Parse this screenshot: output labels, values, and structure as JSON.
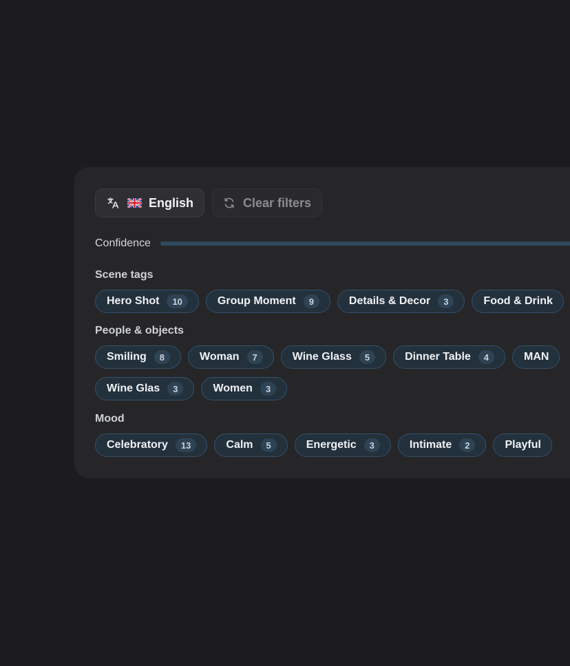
{
  "toolbar": {
    "language_label": "English",
    "language_flag": "uk-flag-icon",
    "translate_icon": "translate-icon",
    "clear_label": "Clear filters",
    "clear_icon": "refresh-icon"
  },
  "confidence": {
    "label": "Confidence"
  },
  "sections": {
    "scene": {
      "label": "Scene tags",
      "chips": [
        {
          "label": "Hero Shot",
          "count": "10"
        },
        {
          "label": "Group Moment",
          "count": "9"
        },
        {
          "label": "Details & Decor",
          "count": "3"
        },
        {
          "label": "Food & Drink",
          "count": ""
        }
      ]
    },
    "people": {
      "label": "People & objects",
      "chips": [
        {
          "label": "Smiling",
          "count": "8"
        },
        {
          "label": "Woman",
          "count": "7"
        },
        {
          "label": "Wine Glass",
          "count": "5"
        },
        {
          "label": "Dinner Table",
          "count": "4"
        },
        {
          "label": "MAN",
          "count": ""
        },
        {
          "label": "Wine Glas",
          "count": "3"
        },
        {
          "label": "Women",
          "count": "3"
        }
      ]
    },
    "mood": {
      "label": "Mood",
      "chips": [
        {
          "label": "Celebratory",
          "count": "13"
        },
        {
          "label": "Calm",
          "count": "5"
        },
        {
          "label": "Energetic",
          "count": "3"
        },
        {
          "label": "Intimate",
          "count": "2"
        },
        {
          "label": "Playful",
          "count": ""
        }
      ]
    }
  },
  "colors": {
    "background": "#1c1c1f",
    "panel": "#262628",
    "chip_border": "#35506a",
    "chip_bg": "#23313d",
    "count_bg": "#2e4354"
  }
}
